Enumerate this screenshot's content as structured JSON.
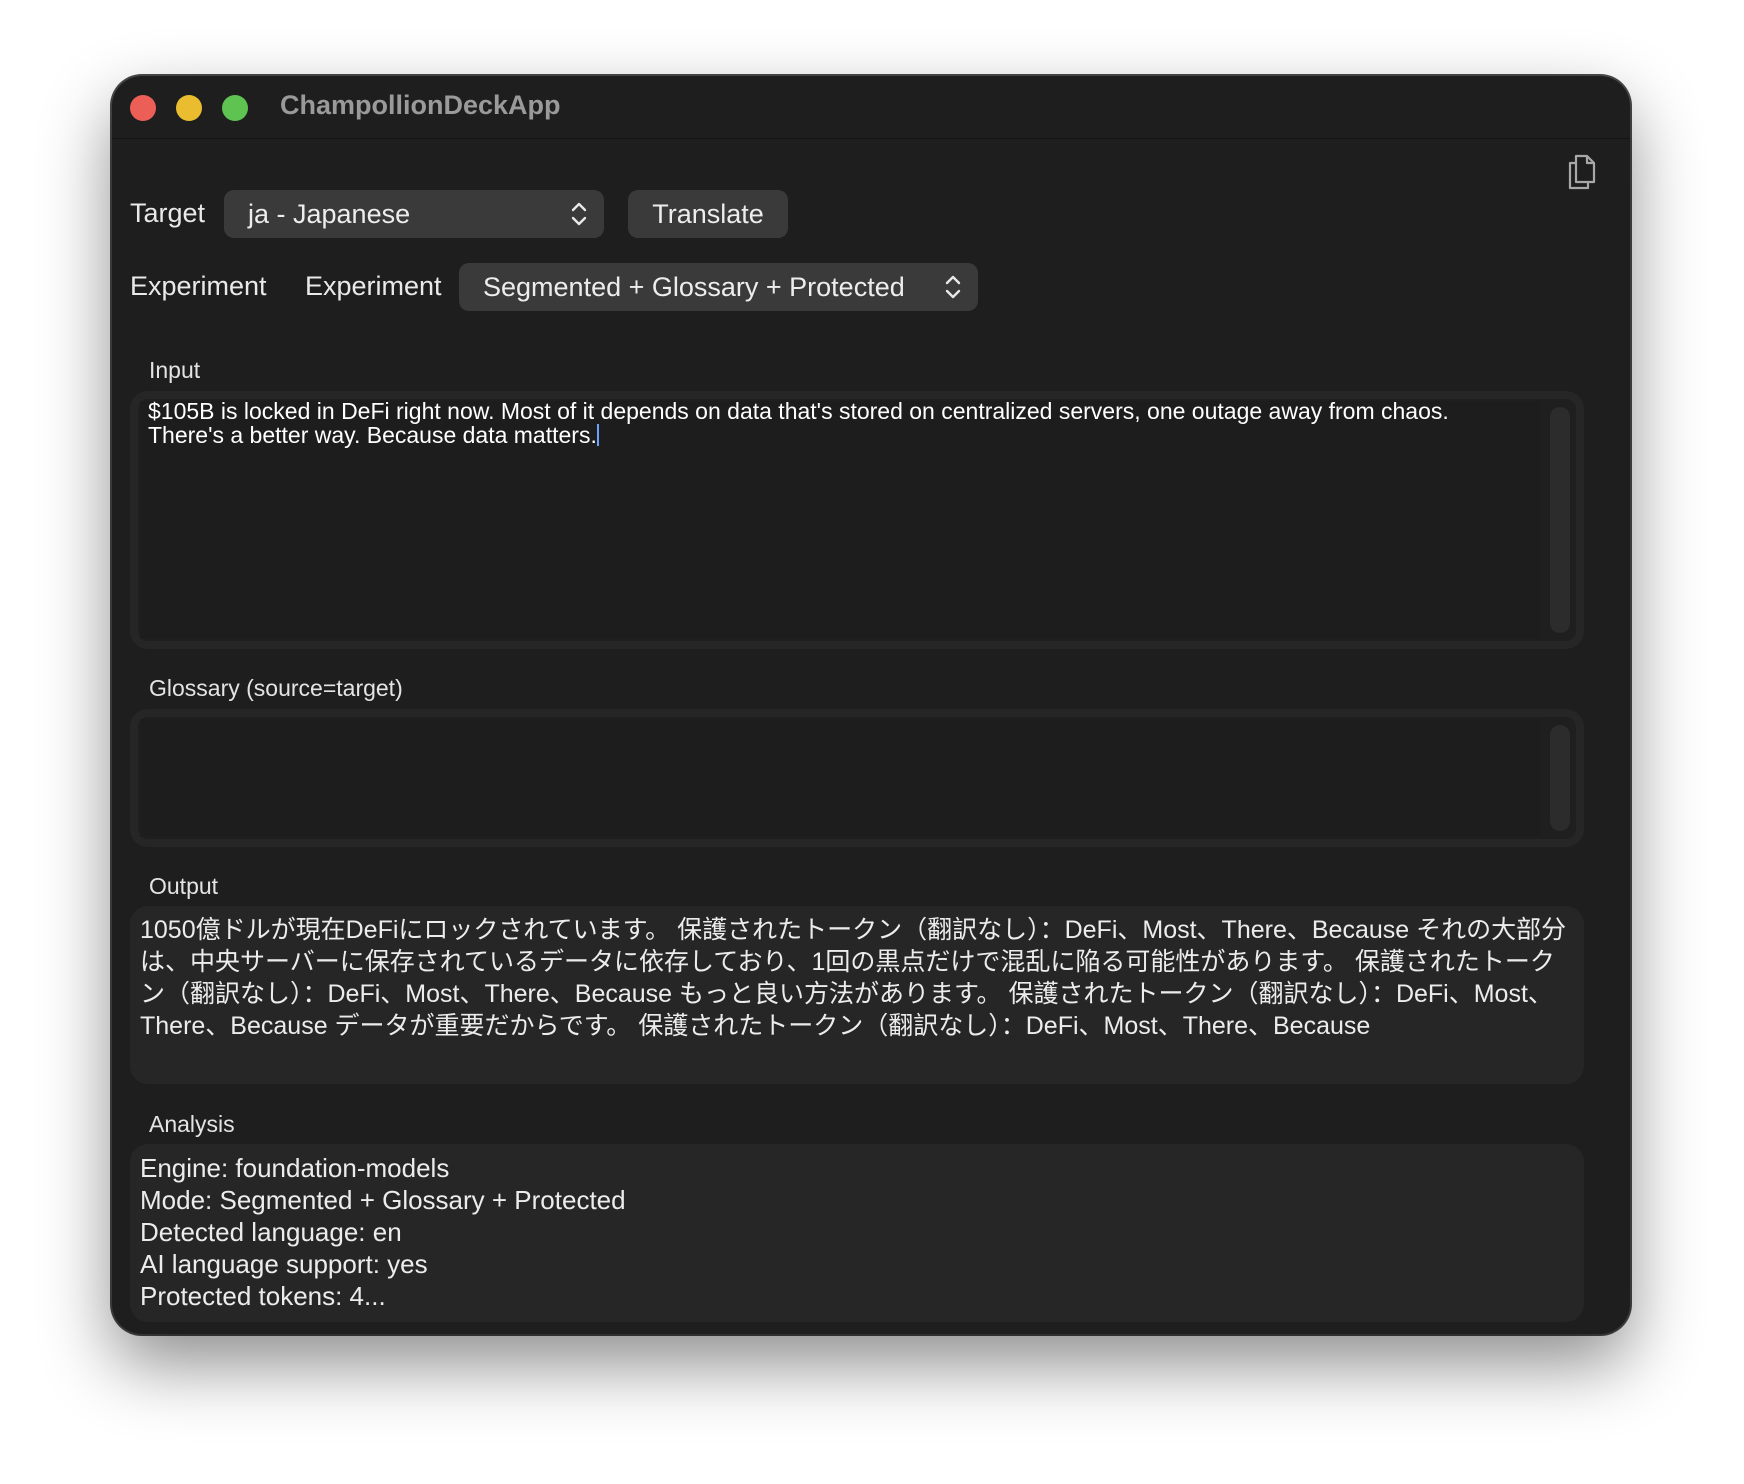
{
  "window": {
    "title": "ChampollionDeckApp"
  },
  "target": {
    "label": "Target",
    "selected": "ja - Japanese",
    "translate_button": "Translate"
  },
  "experiment": {
    "label": "Experiment",
    "picker_label": "Experiment",
    "selected": "Segmented + Glossary + Protected"
  },
  "input": {
    "label": "Input",
    "text": "$105B is locked in DeFi right now. Most of it depends on data that's stored on centralized servers, one outage away from chaos.\nThere's a better way. Because data matters."
  },
  "glossary": {
    "label": "Glossary (source=target)",
    "text": ""
  },
  "output": {
    "label": "Output",
    "text": "1050億ドルが現在DeFiにロックされています。 保護されたトークン（翻訳なし）：DeFi、Most、There、Because それの大部分は、中央サーバーに保存されているデータに依存しており、1回の黒点だけで混乱に陥る可能性があります。 保護されたトークン（翻訳なし）：DeFi、Most、There、Because もっと良い方法があります。 保護されたトークン（翻訳なし）：DeFi、Most、There、Because データが重要だからです。 保護されたトークン（翻訳なし）：DeFi、Most、There、Because"
  },
  "analysis": {
    "label": "Analysis",
    "lines": [
      "Engine: foundation-models",
      "Mode: Segmented + Glossary + Protected",
      "Detected language: en",
      "AI language support: yes",
      "Protected tokens: 4..."
    ]
  },
  "icons": {
    "copy": "copy-icon",
    "chevron": "up-down-chevron-icon"
  },
  "colors": {
    "window_bg": "#1e1e1e",
    "close": "#ec5f57",
    "minimize": "#e9bd2f",
    "maximize": "#5fc352",
    "control_bg": "#3a3a3a"
  }
}
